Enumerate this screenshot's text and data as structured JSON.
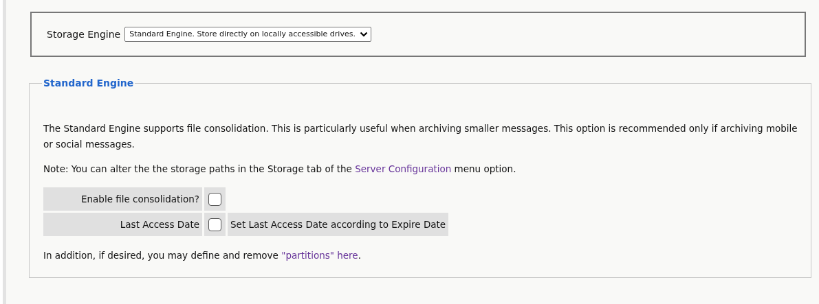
{
  "storage_engine": {
    "label": "Storage Engine",
    "value": "Standard Engine. Store directly on locally accessible drives."
  },
  "section": {
    "legend": "Standard Engine",
    "description": "The Standard Engine supports file consolidation. This is particularly useful when archiving smaller messages. This option is recommended only if archiving mobile or social messages.",
    "note": {
      "before": "Note: You can alter the the storage paths in the Storage tab of the ",
      "link": "Server Configuration",
      "after": " menu option."
    },
    "options": [
      {
        "label": "Enable file consolidation?",
        "checked": false
      },
      {
        "label": "Last Access Date",
        "checked": false,
        "description": "Set Last Access Date according to Expire Date"
      }
    ],
    "footer": {
      "before": "In addition, if desired, you may define and remove ",
      "link": "\"partitions\" here",
      "after": "."
    }
  }
}
